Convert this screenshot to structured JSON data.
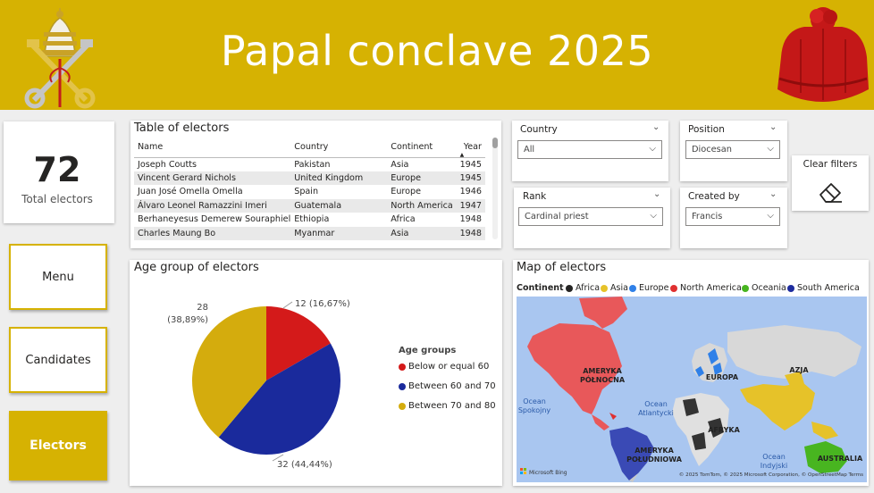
{
  "header": {
    "title": "Papal conclave 2025"
  },
  "kpi": {
    "value": "72",
    "label": "Total electors"
  },
  "nav": {
    "menu": "Menu",
    "candidates": "Candidates",
    "electors": "Electors"
  },
  "table": {
    "title": "Table of electors",
    "columns": [
      "Name",
      "Country",
      "Continent",
      "Year"
    ],
    "rows": [
      [
        "Joseph Coutts",
        "Pakistan",
        "Asia",
        "1945"
      ],
      [
        "Vincent Gerard Nichols",
        "United Kingdom",
        "Europe",
        "1945"
      ],
      [
        "Juan José Omella Omella",
        "Spain",
        "Europe",
        "1946"
      ],
      [
        "Álvaro Leonel Ramazzini Imeri",
        "Guatemala",
        "North America",
        "1947"
      ],
      [
        "Berhaneyesus Demerew Souraphiel",
        "Ethiopia",
        "Africa",
        "1948"
      ],
      [
        "Charles Maung Bo",
        "Myanmar",
        "Asia",
        "1948"
      ]
    ]
  },
  "slicers": {
    "country": {
      "title": "Country",
      "value": "All"
    },
    "position": {
      "title": "Position",
      "value": "Diocesan"
    },
    "rank": {
      "title": "Rank",
      "value": "Cardinal priest"
    },
    "created_by": {
      "title": "Created by",
      "value": "Francis"
    },
    "clear": {
      "label": "Clear filters"
    }
  },
  "pie": {
    "title": "Age group of electors",
    "legend_title": "Age groups",
    "labels": {
      "a": "12 (16,67%)",
      "b": "32 (44,44%)",
      "c1": "28",
      "c2": "(38,89%)"
    }
  },
  "chart_data": {
    "type": "pie",
    "title": "Age group of electors",
    "legend_title": "Age groups",
    "categories": [
      "Below or equal 60",
      "Between 60 and 70",
      "Between 70 and 80"
    ],
    "values": [
      12,
      32,
      28
    ],
    "percentages": [
      16.67,
      44.44,
      38.89
    ],
    "colors": [
      "#d41a1a",
      "#1a2a9c",
      "#d4ac0d"
    ],
    "legend_position": "right"
  },
  "map": {
    "title": "Map of electors",
    "legend_title": "Continent",
    "legend": [
      {
        "name": "Africa",
        "color": "#252423"
      },
      {
        "name": "Asia",
        "color": "#e6c229"
      },
      {
        "name": "Europe",
        "color": "#2f80e8"
      },
      {
        "name": "North America",
        "color": "#e03030"
      },
      {
        "name": "Oceania",
        "color": "#48b520"
      },
      {
        "name": "South America",
        "color": "#1e2c9e"
      }
    ],
    "labels": {
      "na1": "AMERYKA",
      "na2": "PÓŁNOCNA",
      "eu": "EUROPA",
      "az": "AZJA",
      "af": "AFRYKA",
      "sa1": "AMERYKA",
      "sa2": "POŁUDNIOWA",
      "au": "AUSTRALIA",
      "pac1": "Ocean",
      "pac2": "Spokojny",
      "atl1": "Ocean",
      "atl2": "Atlantycki",
      "ind1": "Ocean",
      "ind2": "Indyjski"
    },
    "brand": "Microsoft Bing",
    "attribution": "© 2025 TomTom, © 2025 Microsoft Corporation, © OpenStreetMap Terms"
  },
  "colors": {
    "accent": "#d6b202",
    "pie_red": "#d41a1a",
    "pie_blue": "#1a2a9c",
    "pie_gold": "#d4ac0d",
    "ocean": "#a9c6f0"
  },
  "icons": {
    "emblem": "papal-coat-of-arms",
    "hat": "cardinal-biretta",
    "eraser": "eraser-icon",
    "sort": "sort-asc-icon",
    "chevron": "chevron-down-icon"
  }
}
